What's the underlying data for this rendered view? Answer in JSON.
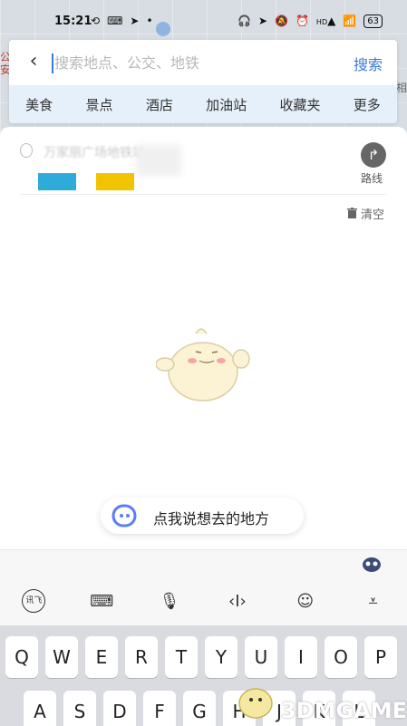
{
  "status_bar": {
    "time": "15:21",
    "icons": [
      "sync-icon",
      "keyboard-icon",
      "navigation-icon",
      "dot-icon",
      "headphones-icon",
      "location-icon",
      "mute-icon",
      "alarm-icon",
      "signal-icon",
      "wifi-icon"
    ],
    "signal_label": "HD",
    "battery": "63"
  },
  "map": {
    "left_text": "公安",
    "right_text": "相"
  },
  "search": {
    "placeholder": "搜索地点、公交、地铁",
    "button_label": "搜索"
  },
  "categories": [
    "美食",
    "景点",
    "酒店",
    "加油站",
    "收藏夹",
    "更多"
  ],
  "history": {
    "item_text": "万家丽广场地铁站",
    "chip_colors": [
      "#2eabd9",
      "#f0c400"
    ]
  },
  "route": {
    "label": "路线"
  },
  "clear": {
    "label": "清空"
  },
  "voice": {
    "label": "点我说想去的地方"
  },
  "keyboard": {
    "toolbar_icons": [
      "handwriting-icon",
      "keyboard-layout-icon",
      "microphone-icon",
      "cursor-move-icon",
      "emoji-icon",
      "collapse-keyboard-icon"
    ],
    "handwriting_label": "讯飞",
    "row1": [
      "Q",
      "W",
      "E",
      "R",
      "T",
      "Y",
      "U",
      "I",
      "O",
      "P"
    ],
    "row2": [
      "A",
      "S",
      "D",
      "F",
      "G",
      "H",
      "J",
      "K",
      "L"
    ]
  },
  "watermark": {
    "text": "3DMGAME"
  }
}
